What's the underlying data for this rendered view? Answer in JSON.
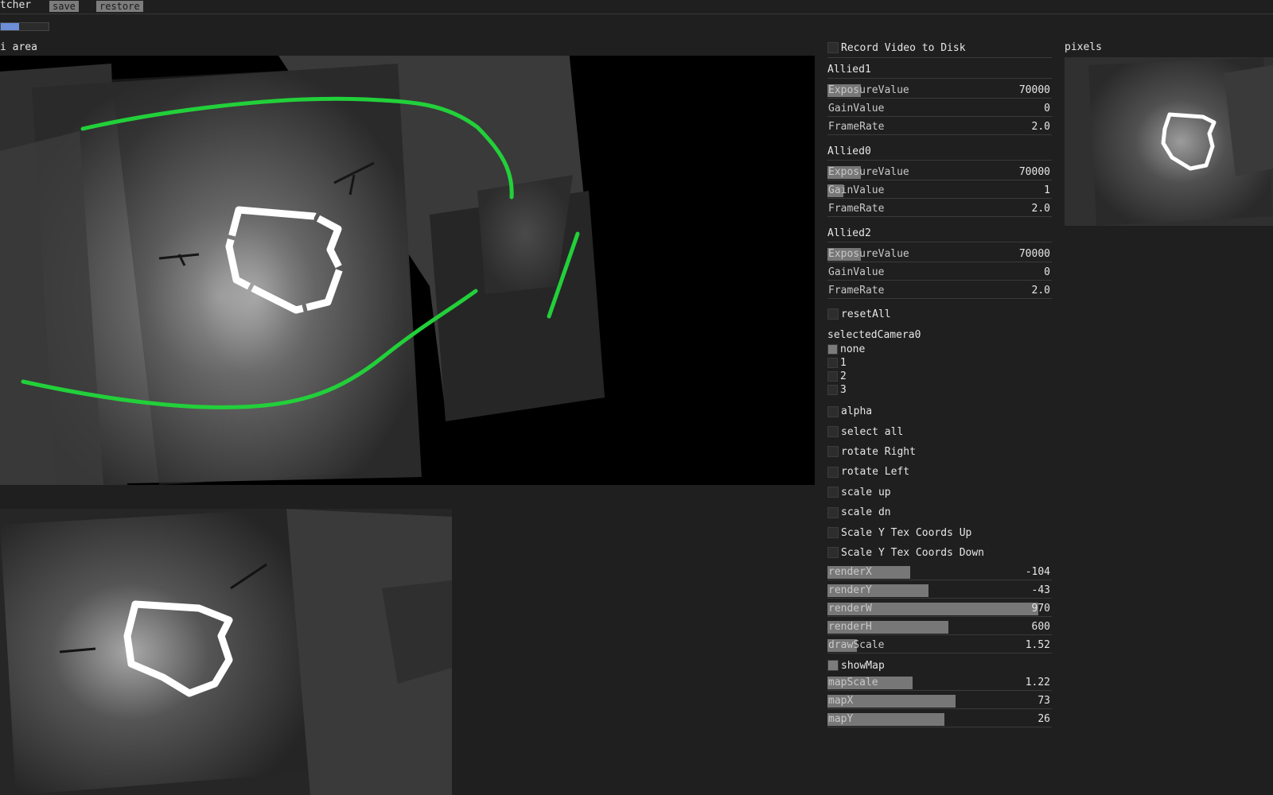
{
  "app": {
    "title": "tcher"
  },
  "toolbar": {
    "save_label": "save",
    "restore_label": "restore"
  },
  "progress": {
    "value": 0.38,
    "color": "#6c8fd8"
  },
  "views": {
    "main_label": "i area",
    "pixels_label": "pixels"
  },
  "colors": {
    "outline_green": "#22d03a",
    "shape_white": "#ffffff"
  },
  "panel": {
    "record_label": "Record Video to Disk",
    "cameras": [
      {
        "title": "Allied1",
        "sliders": [
          {
            "name": "ExposureValue",
            "value": "70000",
            "fraction": 0.15
          },
          {
            "name": "GainValue",
            "value": "0",
            "fraction": 0.0
          },
          {
            "name": "FrameRate",
            "value": "2.0",
            "fraction": 0.0
          }
        ]
      },
      {
        "title": "Allied0",
        "sliders": [
          {
            "name": "ExposureValue",
            "value": "70000",
            "fraction": 0.15
          },
          {
            "name": "GainValue",
            "value": "1",
            "fraction": 0.07
          },
          {
            "name": "FrameRate",
            "value": "2.0",
            "fraction": 0.0
          }
        ]
      },
      {
        "title": "Allied2",
        "sliders": [
          {
            "name": "ExposureValue",
            "value": "70000",
            "fraction": 0.15
          },
          {
            "name": "GainValue",
            "value": "0",
            "fraction": 0.0
          },
          {
            "name": "FrameRate",
            "value": "2.0",
            "fraction": 0.0
          }
        ]
      }
    ],
    "reset_all_label": "resetAll",
    "selected_camera": {
      "title": "selectedCamera0",
      "options": [
        "none",
        "1",
        "2",
        "3"
      ],
      "selected": "none"
    },
    "toggles": [
      "alpha",
      "select all",
      "rotate Right",
      "rotate Left",
      "scale up",
      "scale dn",
      "Scale Y Tex Coords Up",
      "Scale Y Tex Coords Down"
    ],
    "render_sliders": [
      {
        "name": "renderX",
        "value": "-104",
        "fraction": 0.37
      },
      {
        "name": "renderY",
        "value": "-43",
        "fraction": 0.45
      },
      {
        "name": "renderW",
        "value": "970",
        "fraction": 0.94
      },
      {
        "name": "renderH",
        "value": "600",
        "fraction": 0.54
      },
      {
        "name": "drawScale",
        "value": "1.52",
        "fraction": 0.13
      }
    ],
    "show_map": {
      "label": "showMap",
      "checked": true
    },
    "map_sliders": [
      {
        "name": "mapScale",
        "value": "1.22",
        "fraction": 0.38
      },
      {
        "name": "mapX",
        "value": "73",
        "fraction": 0.57
      },
      {
        "name": "mapY",
        "value": "26",
        "fraction": 0.52
      }
    ]
  }
}
